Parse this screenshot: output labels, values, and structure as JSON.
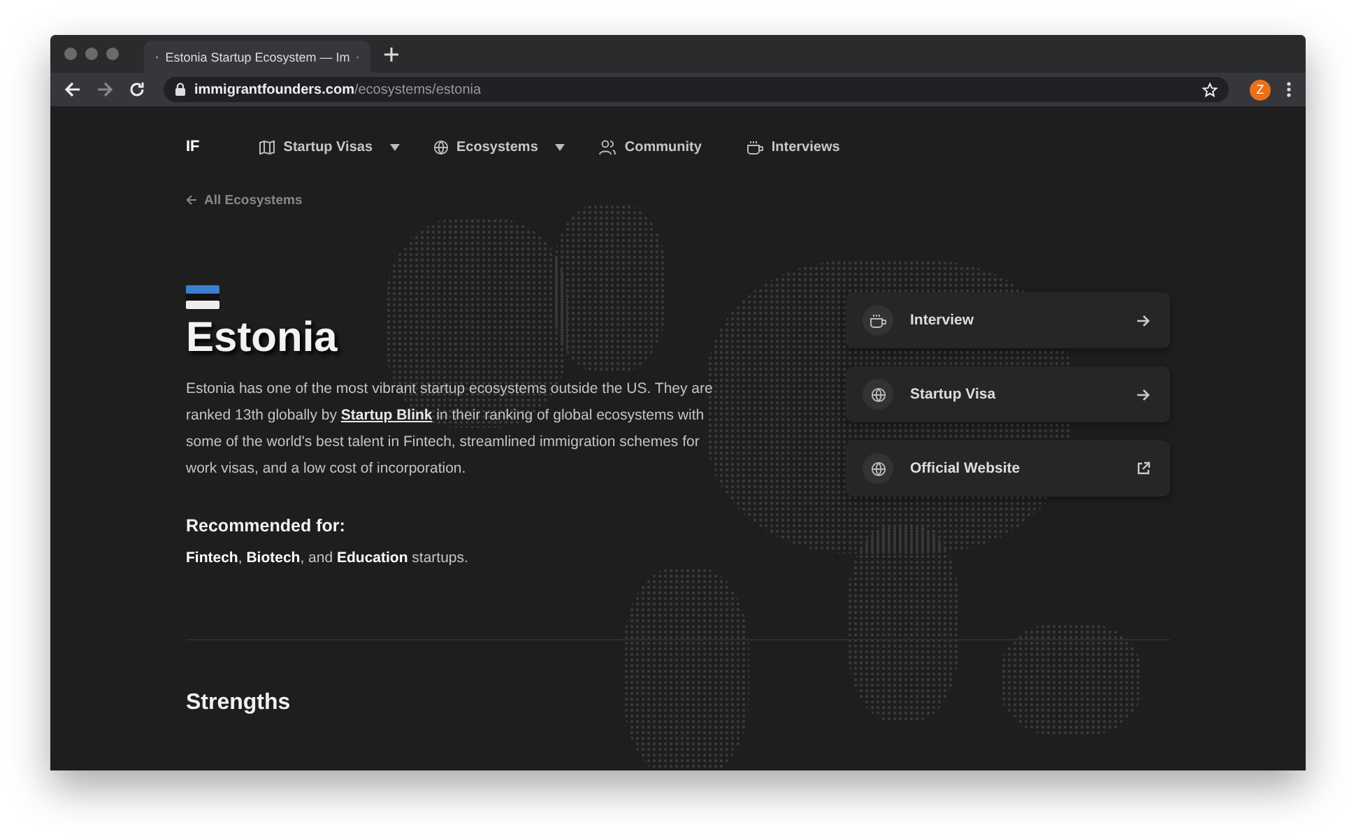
{
  "browser": {
    "tab_title": "Estonia Startup Ecosystem — Im",
    "url_domain": "immigrantfounders.com",
    "url_path": "/ecosystems/estonia",
    "avatar": "Z"
  },
  "nav": {
    "logo": "IF",
    "items": [
      {
        "label": "Startup Visas",
        "dropdown": true
      },
      {
        "label": "Ecosystems",
        "dropdown": true
      },
      {
        "label": "Community",
        "dropdown": false
      },
      {
        "label": "Interviews",
        "dropdown": false
      }
    ]
  },
  "back_link": "All Ecosystems",
  "country": {
    "title": "Estonia",
    "description_before": "Estonia has one of the most vibrant startup ecosystems outside the US. They are ranked 13th globally by",
    "description_link": "Startup Blink",
    "description_after": "in their ranking of global ecosystems with some of the world's best talent in Fintech, streamlined immigration schemes for work visas, and a low cost of incorporation."
  },
  "recommended": {
    "heading": "Recommended for:",
    "text": "**Fintech**, **Biotech**, and **Education** startups."
  },
  "links": [
    {
      "label": "Interview",
      "kind": "internal"
    },
    {
      "label": "Startup Visa",
      "kind": "internal"
    },
    {
      "label": "Official Website",
      "kind": "external"
    }
  ],
  "section_heading": "Strengths"
}
